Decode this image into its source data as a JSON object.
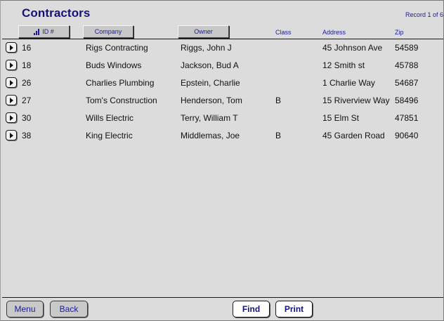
{
  "header": {
    "title": "Contractors",
    "record_status": "Record 1 of 6"
  },
  "columns": {
    "id": "ID #",
    "company": "Company",
    "owner": "Owner",
    "class": "Class",
    "address": "Address",
    "zip": "Zip"
  },
  "rows": [
    {
      "id": "16",
      "company": "Rigs Contracting",
      "owner": "Riggs, John J",
      "class": "",
      "address": "45 Johnson Ave",
      "zip": "54589"
    },
    {
      "id": "18",
      "company": "Buds Windows",
      "owner": "Jackson, Bud A",
      "class": "",
      "address": "12 Smith st",
      "zip": "45788"
    },
    {
      "id": "26",
      "company": "Charlies Plumbing",
      "owner": "Epstein, Charlie",
      "class": "",
      "address": "1 Charlie Way",
      "zip": "54687"
    },
    {
      "id": "27",
      "company": "Tom's Construction",
      "owner": "Henderson, Tom",
      "class": "B",
      "address": "15 Riverview Way",
      "zip": "58496"
    },
    {
      "id": "30",
      "company": "Wills Electric",
      "owner": "Terry, William T",
      "class": "",
      "address": "15 Elm St",
      "zip": "47851"
    },
    {
      "id": "38",
      "company": "King Electric",
      "owner": "Middlemas, Joe",
      "class": "B",
      "address": "45 Garden Road",
      "zip": "90640"
    }
  ],
  "footer": {
    "menu_label": "Menu",
    "back_label": "Back",
    "find_label": "Find",
    "print_label": "Print"
  },
  "icons": {
    "sort": "sort-ascending-icon",
    "row_go": "play-triangle-icon"
  },
  "colors": {
    "accent": "#1a1a9a",
    "title": "#131377",
    "background": "#dcdcdc"
  }
}
